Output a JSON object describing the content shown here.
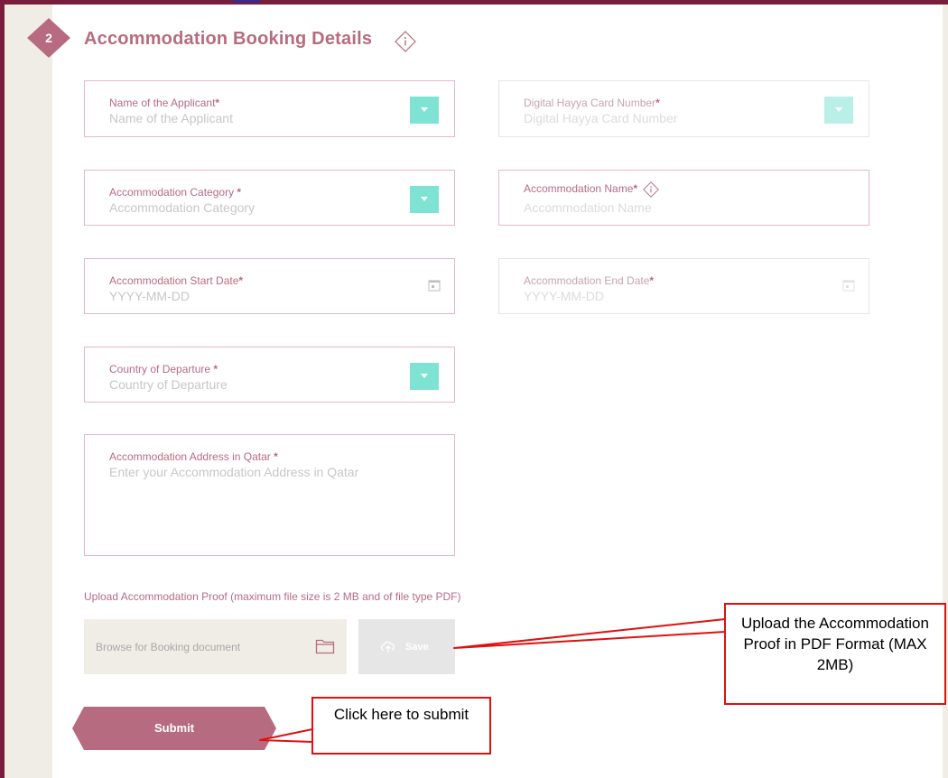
{
  "section": {
    "step_number": "2",
    "title": "Accommodation Booking Details"
  },
  "fields": {
    "applicant_name": {
      "label": "Name of the Applicant",
      "placeholder": "Name of the Applicant"
    },
    "hayya_card": {
      "label": "Digital Hayya Card Number",
      "placeholder": "Digital Hayya Card Number"
    },
    "accommodation_category": {
      "label": "Accommodation Category",
      "placeholder": "Accommodation Category"
    },
    "accommodation_name": {
      "label": "Accommodation Name",
      "placeholder": "Accommodation Name"
    },
    "start_date": {
      "label": "Accommodation Start Date",
      "placeholder": "YYYY-MM-DD"
    },
    "end_date": {
      "label": "Accommodation End Date",
      "placeholder": "YYYY-MM-DD"
    },
    "country_departure": {
      "label": "Country of Departure",
      "placeholder": "Country of Departure"
    },
    "address": {
      "label": "Accommodation Address in Qatar",
      "placeholder": "Enter your Accommodation Address in Qatar"
    }
  },
  "required_marker": "*",
  "upload": {
    "label": "Upload Accommodation Proof (maximum file size is 2 MB and of file type PDF)",
    "browse_placeholder": "Browse for Booking document",
    "save_label": "Save"
  },
  "submit_label": "Submit",
  "callouts": {
    "upload": "Upload the Accommodation Proof in PDF Format (MAX 2MB)",
    "submit": "Click here to submit"
  },
  "colors": {
    "brand": "#b76b80",
    "frame": "#7a1c3c",
    "dropdown": "#7fe3d3",
    "callout_border": "#e01010"
  }
}
